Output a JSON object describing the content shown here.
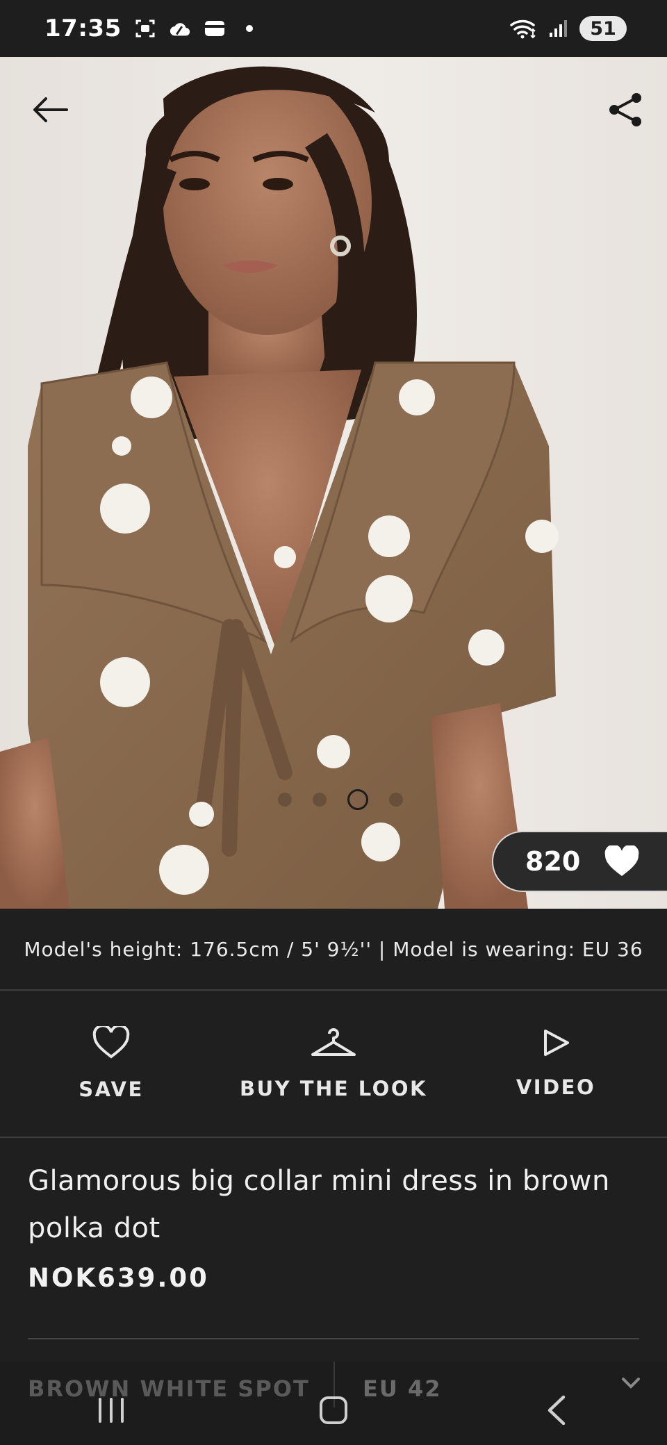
{
  "status_bar": {
    "time": "17:35",
    "battery": "51",
    "icons": [
      "screenshot-icon",
      "cloud-icon",
      "wallet-icon",
      "dot-icon",
      "wifi-icon",
      "signal-icon"
    ]
  },
  "header": {
    "back_icon": "arrow-left-icon",
    "share_icon": "share-icon"
  },
  "gallery": {
    "image": "product-photo",
    "total_images": 4,
    "active_index": 2
  },
  "likes": {
    "count": "820",
    "icon": "heart-filled-icon"
  },
  "model_info": "Model's height: 176.5cm / 5' 9½'' | Model is wearing: EU 36",
  "actions": [
    {
      "label": "SAVE",
      "icon": "heart-outline-icon"
    },
    {
      "label": "BUY THE LOOK",
      "icon": "hanger-icon"
    },
    {
      "label": "VIDEO",
      "icon": "play-icon"
    }
  ],
  "product": {
    "title": "Glamorous big collar mini dress in brown polka dot",
    "price": "NOK639.00"
  },
  "selectors": {
    "color": "BROWN WHITE SPOT",
    "size": "EU 42",
    "chevron_icon": "chevron-down-icon"
  },
  "nav": [
    "recent-apps-icon",
    "home-icon",
    "back-icon"
  ],
  "colors": {
    "background": "#1f1f1f",
    "text": "#ffffff",
    "dress": "#8a6a4e",
    "dots": "#f4f0ea"
  }
}
